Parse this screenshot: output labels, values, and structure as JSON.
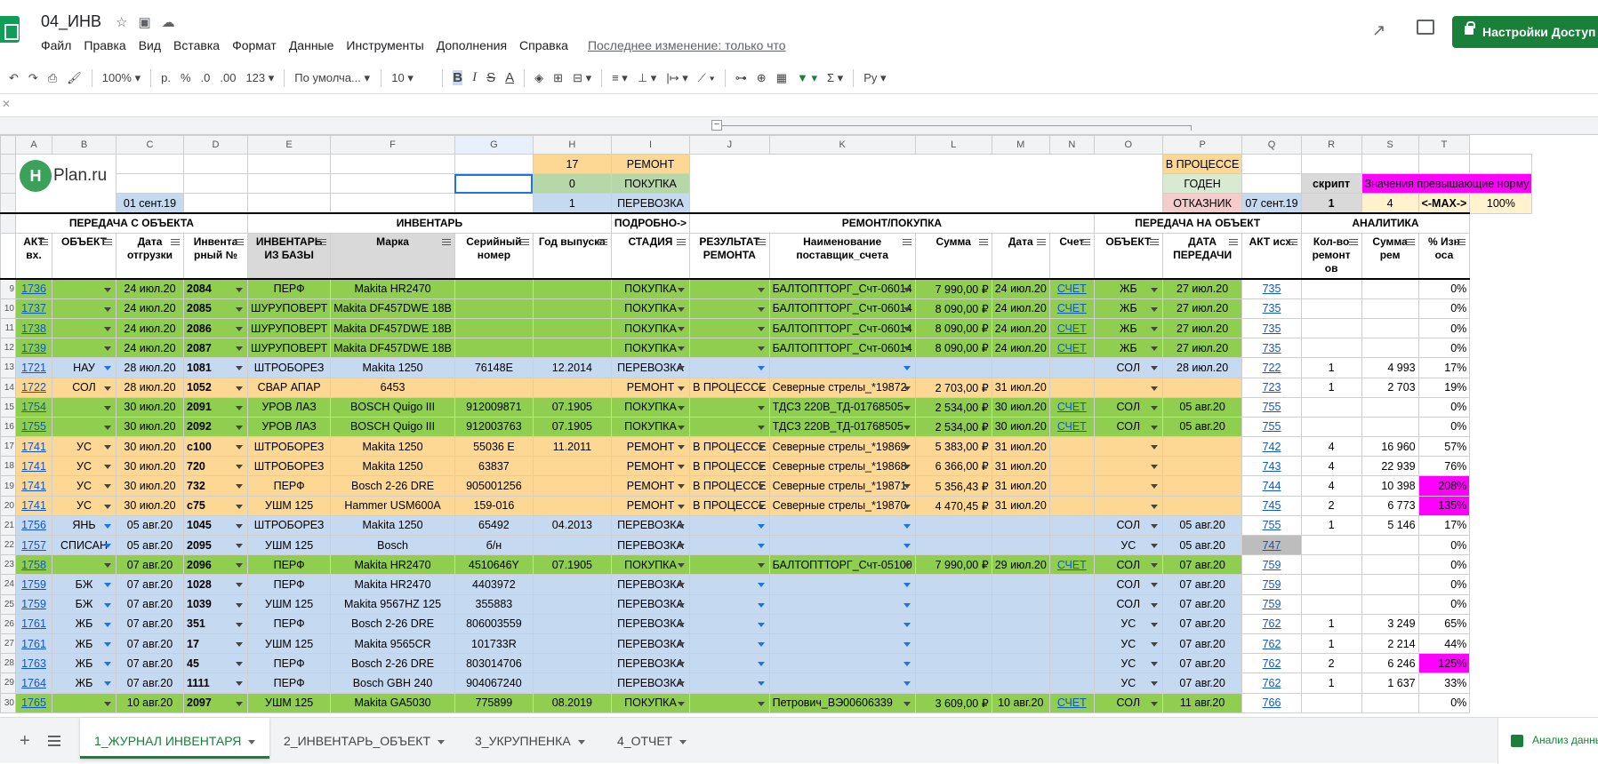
{
  "doc": {
    "title": "04_ИНВ",
    "last_edit": "Последнее изменение: только что",
    "share": "Настройки Доступ"
  },
  "menu": [
    "Файл",
    "Правка",
    "Вид",
    "Вставка",
    "Формат",
    "Данные",
    "Инструменты",
    "Дополнения",
    "Справка"
  ],
  "toolbar": {
    "zoom": "100%",
    "currency": "р.",
    "percent": "%",
    "dec_less": ".0",
    "dec_more": ".00",
    "more_formats": "123",
    "font": "По умолча...",
    "font_size": "10"
  },
  "columns": [
    "A",
    "B",
    "C",
    "D",
    "E",
    "F",
    "G",
    "H",
    "I",
    "J",
    "K",
    "L",
    "M",
    "N",
    "O",
    "P",
    "Q",
    "R",
    "S",
    "T"
  ],
  "logo": {
    "text": "Plan.ru",
    "mark": "H"
  },
  "summary": {
    "count_repair": "17",
    "label_repair": "РЕМОНТ",
    "count_purchase": "0",
    "label_purchase": "ПОКУПКА",
    "count_transport": "1",
    "label_transport": "ПЕРЕВОЗКА",
    "date_c": "01 сент.19",
    "o_inprocess": "В ПРОЦЕССЕ",
    "o_good": "ГОДЕН",
    "o_reject": "ОТКАЗНИК",
    "date_p": "07 сент.19",
    "script_label": "скрипт",
    "script_value": "1",
    "exceed_label": "Значения превышающие норму",
    "r_value": "4",
    "max_label": "<-MAX->",
    "t_value": "100%"
  },
  "sections": {
    "s1": "ПЕРЕДАЧА С ОБЪЕКТА",
    "s2": "ИНВЕНТАРЬ",
    "s3": "ПОДРОБНО->",
    "s4": "РЕМОНТ/ПОКУПКА",
    "s5": "ПЕРЕДАЧА НА ОБЪЕКТ",
    "s6": "АНАЛИТИКА"
  },
  "headers": [
    "АКТ вх.",
    "ОБЪЕКТ",
    "Дата отгрузки",
    "Инвента рный №",
    "ИНВЕНТАРЬ ИЗ БАЗЫ",
    "Марка",
    "Серийный номер",
    "Год выпуска",
    "СТАДИЯ",
    "РЕЗУЛЬТАТ РЕМОНТА",
    "Наименование поставщик_счета",
    "Сумма",
    "Дата",
    "Счет",
    "ОБЪЕКТ",
    "ДАТА ПЕРЕДАЧИ",
    "АКТ исх.",
    "Кол-во ремонт ов",
    "Сумма рем",
    "% Изн оса"
  ],
  "rows": [
    {
      "n": "9",
      "a": "1736",
      "b": "",
      "c": "24 июл.20",
      "d": "2084",
      "e": "ПЕРФ",
      "f": "Makita HR2470",
      "g": "",
      "h": "",
      "i": "ПОКУПКА",
      "j": "",
      "k": "БАЛТОПТТОРГ_Счт-06014",
      "l": "7 990,00 ₽",
      "m": "24 июл.20",
      "n2": "СЧЕТ",
      "o": "ЖБ",
      "p": "27 июл.20",
      "q": "735",
      "r": "",
      "s": "",
      "t": "0%",
      "st": "g"
    },
    {
      "n": "10",
      "a": "1737",
      "b": "",
      "c": "24 июл.20",
      "d": "2085",
      "e": "ШУРУПОВЕРТ",
      "f": "Makita DF457DWE 18В",
      "g": "",
      "h": "",
      "i": "ПОКУПКА",
      "j": "",
      "k": "БАЛТОПТТОРГ_Счт-06014",
      "l": "8 090,00 ₽",
      "m": "24 июл.20",
      "n2": "СЧЕТ",
      "o": "ЖБ",
      "p": "27 июл.20",
      "q": "735",
      "r": "",
      "s": "",
      "t": "0%",
      "st": "g"
    },
    {
      "n": "11",
      "a": "1738",
      "b": "",
      "c": "24 июл.20",
      "d": "2086",
      "e": "ШУРУПОВЕРТ",
      "f": "Makita DF457DWE 18В",
      "g": "",
      "h": "",
      "i": "ПОКУПКА",
      "j": "",
      "k": "БАЛТОПТТОРГ_Счт-06014",
      "l": "8 090,00 ₽",
      "m": "24 июл.20",
      "n2": "СЧЕТ",
      "o": "ЖБ",
      "p": "27 июл.20",
      "q": "735",
      "r": "",
      "s": "",
      "t": "0%",
      "st": "g"
    },
    {
      "n": "12",
      "a": "1739",
      "b": "",
      "c": "24 июл.20",
      "d": "2087",
      "e": "ШУРУПОВЕРТ",
      "f": "Makita DF457DWE 18В",
      "g": "",
      "h": "",
      "i": "ПОКУПКА",
      "j": "",
      "k": "БАЛТОПТТОРГ_Счт-06014",
      "l": "8 090,00 ₽",
      "m": "24 июл.20",
      "n2": "СЧЕТ",
      "o": "ЖБ",
      "p": "27 июл.20",
      "q": "735",
      "r": "",
      "s": "",
      "t": "0%",
      "st": "g"
    },
    {
      "n": "13",
      "a": "1721",
      "b": "НАУ",
      "c": "28 июл.20",
      "d": "1081",
      "e": "ШТРОБОРЕЗ",
      "f": "Makita 1250",
      "g": "76148E",
      "h": "12.2014",
      "i": "ПЕРЕВОЗКА",
      "j": "",
      "k": "",
      "l": "",
      "m": "",
      "n2": "",
      "o": "СОЛ",
      "p": "28 июл.20",
      "q": "722",
      "r": "1",
      "s": "4 993",
      "t": "17%",
      "st": "b"
    },
    {
      "n": "14",
      "a": "1722",
      "b": "СОЛ",
      "c": "28 июл.20",
      "d": "1052",
      "e": "СВАР АПАР",
      "f": "6453",
      "g": "",
      "h": "",
      "i": "РЕМОНТ",
      "j": "В ПРОЦЕССЕ",
      "k": "Северные стрелы_*19872",
      "l": "2 703,00 ₽",
      "m": "31 июл.20",
      "n2": "",
      "o": "",
      "p": "",
      "q": "723",
      "r": "1",
      "s": "2 703",
      "t": "19%",
      "st": "o"
    },
    {
      "n": "15",
      "a": "1754",
      "b": "",
      "c": "30 июл.20",
      "d": "2091",
      "e": "УРОВ ЛАЗ",
      "f": "BOSCH Quigo III",
      "g": "912009871",
      "h": "07.1905",
      "i": "ПОКУПКА",
      "j": "",
      "k": "ТДСЗ 220В_ТД-01768505",
      "l": "2 534,00 ₽",
      "m": "30 июл.20",
      "n2": "СЧЕТ",
      "o": "СОЛ",
      "p": "05 авг.20",
      "q": "755",
      "r": "",
      "s": "",
      "t": "0%",
      "st": "g"
    },
    {
      "n": "16",
      "a": "1755",
      "b": "",
      "c": "30 июл.20",
      "d": "2092",
      "e": "УРОВ ЛАЗ",
      "f": "BOSCH Quigo III",
      "g": "912003763",
      "h": "07.1905",
      "i": "ПОКУПКА",
      "j": "",
      "k": "ТДСЗ 220В_ТД-01768505",
      "l": "2 534,00 ₽",
      "m": "30 июл.20",
      "n2": "СЧЕТ",
      "o": "СОЛ",
      "p": "05 авг.20",
      "q": "755",
      "r": "",
      "s": "",
      "t": "0%",
      "st": "g"
    },
    {
      "n": "17",
      "a": "1741",
      "b": "УС",
      "c": "30 июл.20",
      "d": "с100",
      "e": "ШТРОБОРЕЗ",
      "f": "Makita 1250",
      "g": "55036 E",
      "h": "11.2011",
      "i": "РЕМОНТ",
      "j": "В ПРОЦЕССЕ",
      "k": "Северные стрелы_*19869",
      "l": "5 383,00 ₽",
      "m": "31 июл.20",
      "n2": "",
      "o": "",
      "p": "",
      "q": "742",
      "r": "4",
      "s": "16 960",
      "t": "57%",
      "st": "o"
    },
    {
      "n": "18",
      "a": "1741",
      "b": "УС",
      "c": "30 июл.20",
      "d": "720",
      "e": "ШТРОБОРЕЗ",
      "f": "Makita 1250",
      "g": "63837",
      "h": "",
      "i": "РЕМОНТ",
      "j": "В ПРОЦЕССЕ",
      "k": "Северные стрелы_*19868",
      "l": "6 366,00 ₽",
      "m": "31 июл.20",
      "n2": "",
      "o": "",
      "p": "",
      "q": "743",
      "r": "4",
      "s": "22 939",
      "t": "76%",
      "st": "o"
    },
    {
      "n": "19",
      "a": "1741",
      "b": "УС",
      "c": "30 июл.20",
      "d": "732",
      "e": "ПЕРФ",
      "f": "Bosch 2-26 DRE",
      "g": "905001256",
      "h": "",
      "i": "РЕМОНТ",
      "j": "В ПРОЦЕССЕ",
      "k": "Северные стрелы_*19871",
      "l": "5 356,43 ₽",
      "m": "31 июл.20",
      "n2": "",
      "o": "",
      "p": "",
      "q": "744",
      "r": "4",
      "s": "10 398",
      "t": "208%",
      "st": "o",
      "tm": true
    },
    {
      "n": "20",
      "a": "1741",
      "b": "УС",
      "c": "30 июл.20",
      "d": "с75",
      "e": "УШМ 125",
      "f": "Hammer USM600A",
      "g": "159-016",
      "h": "",
      "i": "РЕМОНТ",
      "j": "В ПРОЦЕССЕ",
      "k": "Северные стрелы_*19870",
      "l": "4 470,45 ₽",
      "m": "31 июл.20",
      "n2": "",
      "o": "",
      "p": "",
      "q": "745",
      "r": "2",
      "s": "6 773",
      "t": "135%",
      "st": "o",
      "tm": true
    },
    {
      "n": "21",
      "a": "1756",
      "b": "ЯНЬ",
      "c": "05 авг.20",
      "d": "1045",
      "e": "ШТРОБОРЕЗ",
      "f": "Makita 1250",
      "g": "65492",
      "h": "04.2013",
      "i": "ПЕРЕВОЗКА",
      "j": "",
      "k": "",
      "l": "",
      "m": "",
      "n2": "",
      "o": "СОЛ",
      "p": "05 авг.20",
      "q": "755",
      "r": "1",
      "s": "5 146",
      "t": "17%",
      "st": "b"
    },
    {
      "n": "22",
      "a": "1757",
      "b": "СПИСАН",
      "c": "05 авг.20",
      "d": "2095",
      "e": "УШМ 125",
      "f": "Bosch",
      "g": "б/н",
      "h": "",
      "i": "ПЕРЕВОЗКА",
      "j": "",
      "k": "",
      "l": "",
      "m": "",
      "n2": "",
      "o": "УС",
      "p": "05 авг.20",
      "q": "747",
      "r": "",
      "s": "",
      "t": "0%",
      "st": "b"
    },
    {
      "n": "23",
      "a": "1758",
      "b": "",
      "c": "07 авг.20",
      "d": "2096",
      "e": "ПЕРФ",
      "f": "Makita HR2470",
      "g": "4510646Y",
      "h": "07.1905",
      "i": "ПОКУПКА",
      "j": "",
      "k": "БАЛТОПТТОРГ_Счт-05100",
      "l": "7 990,00 ₽",
      "m": "29 июл.20",
      "n2": "СЧЕТ",
      "o": "СОЛ",
      "p": "07 авг.20",
      "q": "759",
      "r": "",
      "s": "",
      "t": "0%",
      "st": "g"
    },
    {
      "n": "24",
      "a": "1759",
      "b": "БЖ",
      "c": "07 авг.20",
      "d": "1028",
      "e": "ПЕРФ",
      "f": "Makita HR2470",
      "g": "4403972",
      "h": "",
      "i": "ПЕРЕВОЗКА",
      "j": "",
      "k": "",
      "l": "",
      "m": "",
      "n2": "",
      "o": "СОЛ",
      "p": "07 авг.20",
      "q": "759",
      "r": "",
      "s": "",
      "t": "0%",
      "st": "b"
    },
    {
      "n": "25",
      "a": "1759",
      "b": "БЖ",
      "c": "07 авг.20",
      "d": "1039",
      "e": "УШМ 125",
      "f": "Makita 9567HZ 125",
      "g": "355883",
      "h": "",
      "i": "ПЕРЕВОЗКА",
      "j": "",
      "k": "",
      "l": "",
      "m": "",
      "n2": "",
      "o": "СОЛ",
      "p": "07 авг.20",
      "q": "759",
      "r": "",
      "s": "",
      "t": "0%",
      "st": "b"
    },
    {
      "n": "26",
      "a": "1761",
      "b": "ЖБ",
      "c": "07 авг.20",
      "d": "351",
      "e": "ПЕРФ",
      "f": "Bosch 2-26 DRE",
      "g": "806003559",
      "h": "",
      "i": "ПЕРЕВОЗКА",
      "j": "",
      "k": "",
      "l": "",
      "m": "",
      "n2": "",
      "o": "УС",
      "p": "07 авг.20",
      "q": "762",
      "r": "1",
      "s": "3 249",
      "t": "65%",
      "st": "b"
    },
    {
      "n": "27",
      "a": "1761",
      "b": "ЖБ",
      "c": "07 авг.20",
      "d": "17",
      "e": "УШМ 125",
      "f": "Makita 9565CR",
      "g": "101733R",
      "h": "",
      "i": "ПЕРЕВОЗКА",
      "j": "",
      "k": "",
      "l": "",
      "m": "",
      "n2": "",
      "o": "УС",
      "p": "07 авг.20",
      "q": "762",
      "r": "1",
      "s": "2 214",
      "t": "44%",
      "st": "b"
    },
    {
      "n": "28",
      "a": "1763",
      "b": "ЖБ",
      "c": "07 авг.20",
      "d": "45",
      "e": "ПЕРФ",
      "f": "Bosch 2-26 DRE",
      "g": "803014706",
      "h": "",
      "i": "ПЕРЕВОЗКА",
      "j": "",
      "k": "",
      "l": "",
      "m": "",
      "n2": "",
      "o": "УС",
      "p": "07 авг.20",
      "q": "762",
      "r": "2",
      "s": "6 246",
      "t": "125%",
      "st": "b",
      "tm": true
    },
    {
      "n": "29",
      "a": "1764",
      "b": "ЖБ",
      "c": "07 авг.20",
      "d": "1111",
      "e": "ПЕРФ",
      "f": "Bosch GBH 240",
      "g": "904067240",
      "h": "",
      "i": "ПЕРЕВОЗКА",
      "j": "",
      "k": "",
      "l": "",
      "m": "",
      "n2": "",
      "o": "УС",
      "p": "07 авг.20",
      "q": "762",
      "r": "1",
      "s": "1 637",
      "t": "33%",
      "st": "b"
    },
    {
      "n": "30",
      "a": "1765",
      "b": "",
      "c": "10 авг.20",
      "d": "2097",
      "e": "УШМ 125",
      "f": "Makita GA5030",
      "g": "775899",
      "h": "08.2019",
      "i": "ПОКУПКА",
      "j": "",
      "k": "Петрович_ВЭ00606339",
      "l": "3 609,00 ₽",
      "m": "10 авг.20",
      "n2": "СЧЕТ",
      "o": "СОЛ",
      "p": "11 авг.20",
      "q": "766",
      "r": "",
      "s": "",
      "t": "0%",
      "st": "g"
    }
  ],
  "tabs": [
    {
      "label": "1_ЖУРНАЛ ИНВЕНТАРЯ",
      "active": true
    },
    {
      "label": "2_ИНВЕНТАРЬ_ОБЪЕКТ",
      "active": false
    },
    {
      "label": "3_УКРУПНЕНКА",
      "active": false
    },
    {
      "label": "4_ОТЧЕТ",
      "active": false
    }
  ],
  "explore": "Анализ данных",
  "colors": {
    "green": "#8fce4e",
    "blue": "#c5d9f1",
    "orange": "#fcd894",
    "magenta": "#ff00ff",
    "brand": "#188038"
  }
}
